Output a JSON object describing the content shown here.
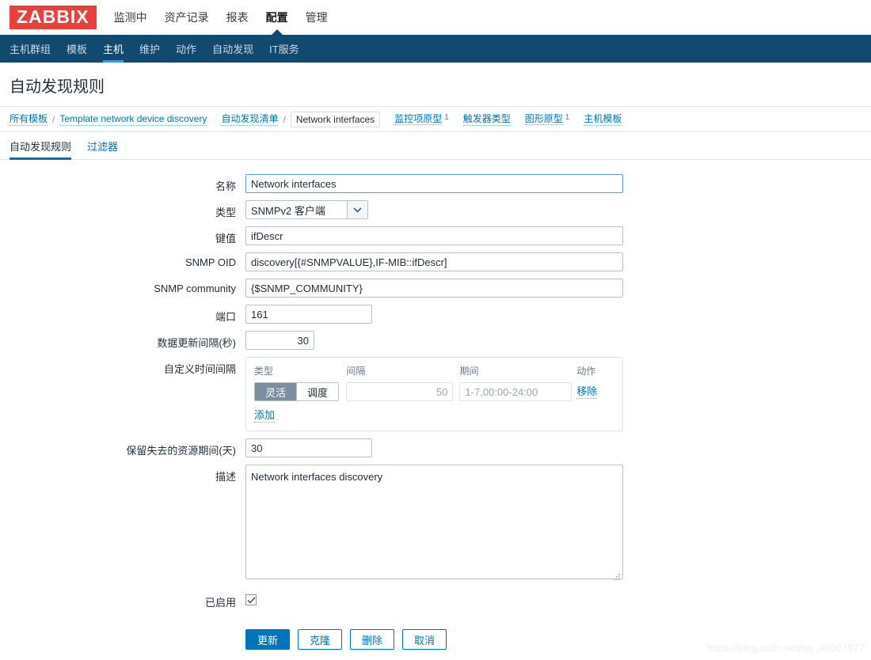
{
  "header": {
    "logo": "ZABBIX",
    "menu": [
      {
        "label": "监测中",
        "active": false
      },
      {
        "label": "资产记录",
        "active": false
      },
      {
        "label": "报表",
        "active": false
      },
      {
        "label": "配置",
        "active": true
      },
      {
        "label": "管理",
        "active": false
      }
    ],
    "subnav": [
      {
        "label": "主机群组",
        "active": false
      },
      {
        "label": "模板",
        "active": false
      },
      {
        "label": "主机",
        "active": true
      },
      {
        "label": "维护",
        "active": false
      },
      {
        "label": "动作",
        "active": false
      },
      {
        "label": "自动发现",
        "active": false
      },
      {
        "label": "IT服务",
        "active": false
      }
    ]
  },
  "page": {
    "title": "自动发现规则"
  },
  "breadcrumb": {
    "all_templates": "所有模板",
    "template_name": "Template network device discovery",
    "discovery_list": "自动发现清单",
    "current": "Network interfaces",
    "item_prototypes": "监控项原型",
    "item_prototypes_count": "1",
    "trigger_prototypes": "触发器类型",
    "graph_prototypes": "图形原型",
    "graph_prototypes_count": "1",
    "host_prototypes": "主机模板",
    "separator": "/"
  },
  "tabs": [
    {
      "label": "自动发现规则",
      "active": true
    },
    {
      "label": "过滤器",
      "active": false
    }
  ],
  "form": {
    "name": {
      "label": "名称",
      "value": "Network interfaces"
    },
    "type": {
      "label": "类型",
      "value": "SNMPv2 客户端"
    },
    "key": {
      "label": "键值",
      "value": "ifDescr"
    },
    "snmp_oid": {
      "label": "SNMP OID",
      "value": "discovery[{#SNMPVALUE},IF-MIB::ifDescr]"
    },
    "snmp_community": {
      "label": "SNMP community",
      "value": "{$SNMP_COMMUNITY}"
    },
    "port": {
      "label": "端口",
      "value": "161"
    },
    "update_interval": {
      "label": "数据更新间隔(秒)",
      "value": "30"
    },
    "custom_intervals": {
      "label": "自定义时间间隔",
      "columns": {
        "type": "类型",
        "interval": "间隔",
        "period": "期间",
        "action": "动作"
      },
      "rows": [
        {
          "type_flexible": "灵活",
          "type_scheduling": "调度",
          "type_selected": "灵活",
          "interval_placeholder": "50",
          "interval_value": "",
          "period_placeholder": "1-7,00:00-24:00",
          "period_value": "",
          "remove_label": "移除"
        }
      ],
      "add_label": "添加"
    },
    "lost_resources": {
      "label": "保留失去的资源期间(天)",
      "value": "30"
    },
    "description": {
      "label": "描述",
      "value": "Network interfaces discovery"
    },
    "enabled": {
      "label": "已启用",
      "checked": true
    }
  },
  "buttons": {
    "update": "更新",
    "clone": "克隆",
    "delete": "删除",
    "cancel": "取消"
  },
  "watermark": "https://blog.csdn.net/qq_40907977",
  "colors": {
    "brand_red": "#e8403a",
    "nav_dark": "#12496f",
    "link_blue": "#0275b8",
    "accent_underline": "#3a9bdc"
  }
}
